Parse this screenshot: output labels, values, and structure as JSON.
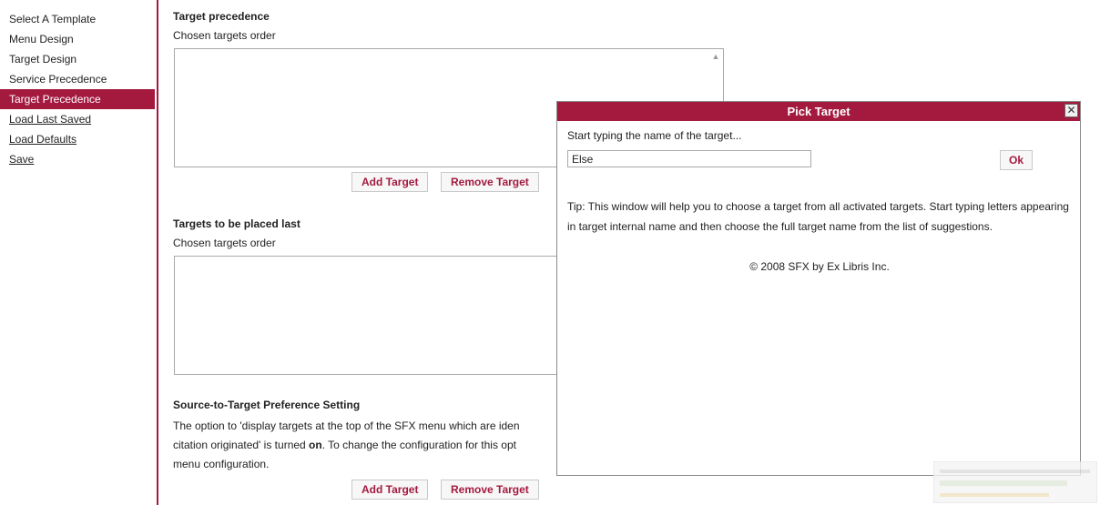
{
  "nav": {
    "items": [
      {
        "label": "Select A Template",
        "state": "normal"
      },
      {
        "label": "Menu Design",
        "state": "normal"
      },
      {
        "label": "Target Design",
        "state": "normal"
      },
      {
        "label": "Service Precedence",
        "state": "normal"
      },
      {
        "label": "Target Precedence",
        "state": "active"
      },
      {
        "label": "Load Last Saved",
        "state": "link"
      },
      {
        "label": "Load Defaults",
        "state": "link"
      },
      {
        "label": "Save",
        "state": "link"
      }
    ]
  },
  "main": {
    "section1": {
      "title": "Target precedence",
      "subtitle": "Chosen targets order",
      "add_label": "Add Target",
      "remove_label": "Remove Target"
    },
    "section2": {
      "title": "Targets to be placed last",
      "subtitle": "Chosen targets order"
    },
    "section3": {
      "title": "Source-to-Target Preference Setting",
      "line1": "The option to 'display targets at the top of the SFX menu which are iden",
      "line2_before": "citation originated' is turned ",
      "line2_bold": "on",
      "line2_after": ". To change the configuration for this opt",
      "line3": "menu configuration.",
      "add_label": "Add Target",
      "remove_label": "Remove Target"
    }
  },
  "dialog": {
    "title": "Pick Target",
    "close_glyph": "✕",
    "prompt": "Start typing the name of the target...",
    "input_value": "Else",
    "ok_label": "Ok",
    "tip": "Tip: This window will help you to choose a target from all activated targets. Start typing letters appearing in target internal name and then choose the full target name from the list of suggestions.",
    "copyright": "© 2008 SFX by Ex Libris Inc."
  },
  "colors": {
    "accent": "#a41a3f"
  }
}
